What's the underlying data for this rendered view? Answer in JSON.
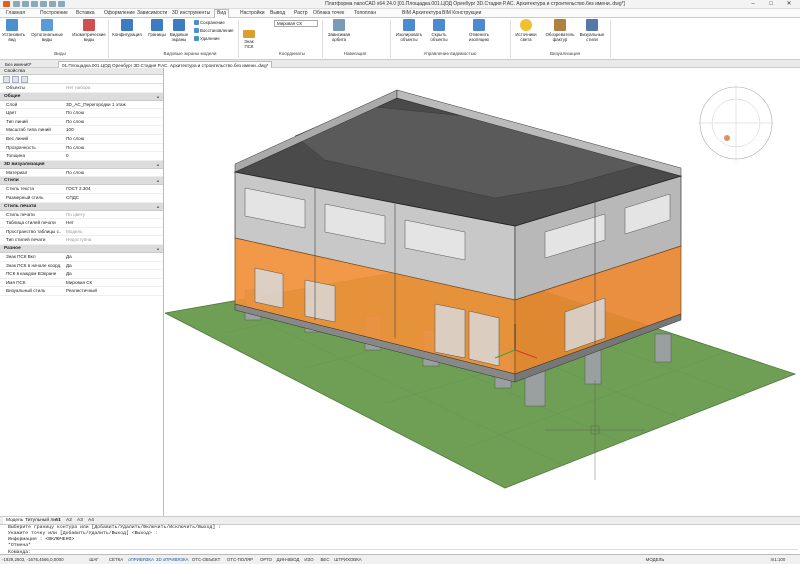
{
  "title": "Платформа nanoCAD x64 24.0 [01.Площадка.001.ЦОД Оренбург 3D.Стадия Р.АС. Архитектура и строительство.без имени..dwg*]",
  "menu": [
    "Главная",
    "Построение",
    "Вставка",
    "Оформление",
    "Зависимости",
    "3D инструменты",
    "Вид",
    "Настройки",
    "Вывод",
    "Растр",
    "Облака точек",
    "Топоплан",
    "BIM Архитектура",
    "BIM Конструкции"
  ],
  "menu_active": "Вид",
  "ribbon": {
    "btn_set_view": "Установить\nвид",
    "btn_ortho": "Ортогональные\nвиды",
    "btn_iso": "Изометрические\nвиды",
    "group_views": "Виды",
    "btn_config": "Конфигурация",
    "btn_borders": "Границы",
    "btn_screens": "Видовые\nэкраны",
    "vp_save": "Сохранение",
    "vp_restore": "Восстановление",
    "vp_delete": "Удаление",
    "group_viewports": "Видовые экраны модели",
    "ucs_label": "Знак\nПСК",
    "ucs_select": "Мировая СК",
    "group_coords": "Координаты",
    "btn_orbit": "Зависимая\nорбита",
    "group_nav": "Навигация",
    "btn_isolate": "Изолировать\nобъекты",
    "btn_hide": "Скрыть\nобъекты",
    "btn_cancel_iso": "Отменить\nизоляцию",
    "group_visibility": "Управление видимостью",
    "btn_lights": "Источники\nсвета",
    "btn_textures": "Обозреватель\nфактур",
    "btn_visual": "Визуальные\nстили",
    "group_visual": "Визуализация"
  },
  "doc_tabs": [
    "Без имени0*",
    "01.Площадка.001.ЦОД Оренбург 3D.Стадия Р.АС. Архитектура и строительство.без имени..dwg*"
  ],
  "props": {
    "title": "Свойства",
    "objects_label": "Объекты",
    "objects_value": "Нет набора",
    "sections": [
      {
        "name": "Общие",
        "rows": [
          {
            "k": "Слой",
            "v": "3D_АС_Перегородки 1 этаж"
          },
          {
            "k": "Цвет",
            "v": "По слою"
          },
          {
            "k": "Тип линий",
            "v": "По слою"
          },
          {
            "k": "Масштаб типа линий",
            "v": "100"
          },
          {
            "k": "Вес линий",
            "v": "По слою"
          },
          {
            "k": "Прозрачность",
            "v": "По слою"
          },
          {
            "k": "Толщина",
            "v": "0"
          }
        ]
      },
      {
        "name": "3D визуализация",
        "rows": [
          {
            "k": "Материал",
            "v": "По слою"
          }
        ]
      },
      {
        "name": "Стили",
        "rows": [
          {
            "k": "Стиль текста",
            "v": "ГОСТ 2.304"
          },
          {
            "k": "Размерный стиль",
            "v": "СПДС"
          }
        ]
      },
      {
        "name": "Стиль печати",
        "rows": [
          {
            "k": "Стиль печати",
            "v": "По цвету",
            "dim": true
          },
          {
            "k": "Таблица стилей печати",
            "v": "Нет"
          },
          {
            "k": "Пространство таблицы с...",
            "v": "Модель",
            "dim": true
          },
          {
            "k": "Тип стилей печати",
            "v": "Недоступна",
            "dim": true
          }
        ]
      },
      {
        "name": "Разное",
        "rows": [
          {
            "k": "Знак ПСК Вкл",
            "v": "Да"
          },
          {
            "k": "Знак ПСК в начале коорд...",
            "v": "Да"
          },
          {
            "k": "ПСК в каждом ВЭкране",
            "v": "Да"
          },
          {
            "k": "Имя ПСК",
            "v": "Мировая СК"
          },
          {
            "k": "Визуальный стиль",
            "v": "Реалистичный"
          }
        ]
      }
    ]
  },
  "bottom_tabs": [
    "Модель",
    "Титульный лист",
    "A1",
    "A2",
    "A3",
    "A4"
  ],
  "command_lines": [
    "Выберите границу контура или [Добавить/Удалить/Включить/Исключить/Выход] :",
    "Укажите точку или [Добавить/Удалить/Выход] <Выход> :",
    "Информация : <ВКЛЮЧЕНО>",
    "*Отмена*",
    "Команда:"
  ],
  "status": {
    "coords": "-1929,2603, -1676,4566,0,0000",
    "toggles": [
      "ШАГ",
      "СЕТКА",
      "оПРИВЯЗКА",
      "3D оПРИВЯЗКА",
      "ОТС-ОБЪЕКТ",
      "ОТС-ПОЛЯР",
      "ОРТО",
      "ДИН-ВВОД",
      "ИЗО",
      "ВЕС",
      "ШТРИХОВКА"
    ],
    "model": "МОДЕЛЬ",
    "scale": "m1:100"
  },
  "colors": {
    "accent": "#1a5fa8",
    "orange": "#f0903a",
    "grass": "#6e9f55",
    "roof": "#444"
  }
}
